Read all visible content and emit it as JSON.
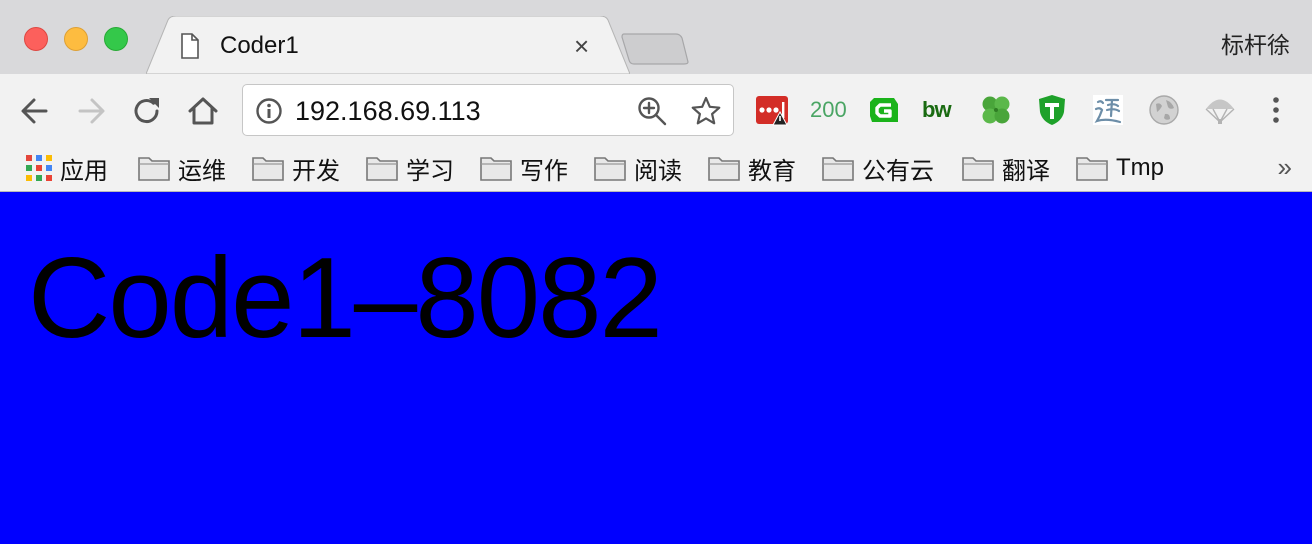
{
  "window": {
    "profile_name": "标杆徐",
    "controls": [
      "close-button",
      "minimize-button",
      "maximize-button"
    ]
  },
  "tab": {
    "title": "Coder1",
    "close_glyph": "×",
    "icon": "page-icon"
  },
  "toolbar": {
    "back_icon": "arrow-left-icon",
    "forward_icon": "arrow-right-icon",
    "reload_icon": "reload-icon",
    "home_icon": "home-icon",
    "url": "192.168.69.113",
    "security_icon": "info-icon",
    "zoom_icon": "zoom-in-icon",
    "bookmark_icon": "star-icon"
  },
  "extensions": [
    {
      "name": "lastpass-extension",
      "icon": "lastpass-warning-icon",
      "color": "#d32d27"
    },
    {
      "name": "http-status-extension",
      "label": "200",
      "color": "#4aa564"
    },
    {
      "name": "grammarly-extension",
      "icon": "g-icon",
      "color": "#1bb31b"
    },
    {
      "name": "bw-extension",
      "label": "bw",
      "color": "#1a6b12"
    },
    {
      "name": "clover-extension",
      "icon": "clover-icon",
      "color": "#49a53a"
    },
    {
      "name": "t-shield-extension",
      "icon": "t-shield-icon",
      "color": "#1ea12a"
    },
    {
      "name": "calligraphy-extension",
      "icon": "calligraphy-icon",
      "color": "#6d8ea8"
    },
    {
      "name": "globe-extension",
      "icon": "globe-icon",
      "color": "#b0b0b0"
    },
    {
      "name": "parachute-extension",
      "icon": "parachute-icon",
      "color": "#b8b8b8"
    }
  ],
  "bookmarks": {
    "apps_label": "应用",
    "folders": [
      "运维",
      "开发",
      "学习",
      "写作",
      "阅读",
      "教育",
      "公有云",
      "翻译",
      "Tmp"
    ],
    "more_glyph": "»"
  },
  "page": {
    "background": "#0000ff",
    "heading": "Code1–8082"
  }
}
